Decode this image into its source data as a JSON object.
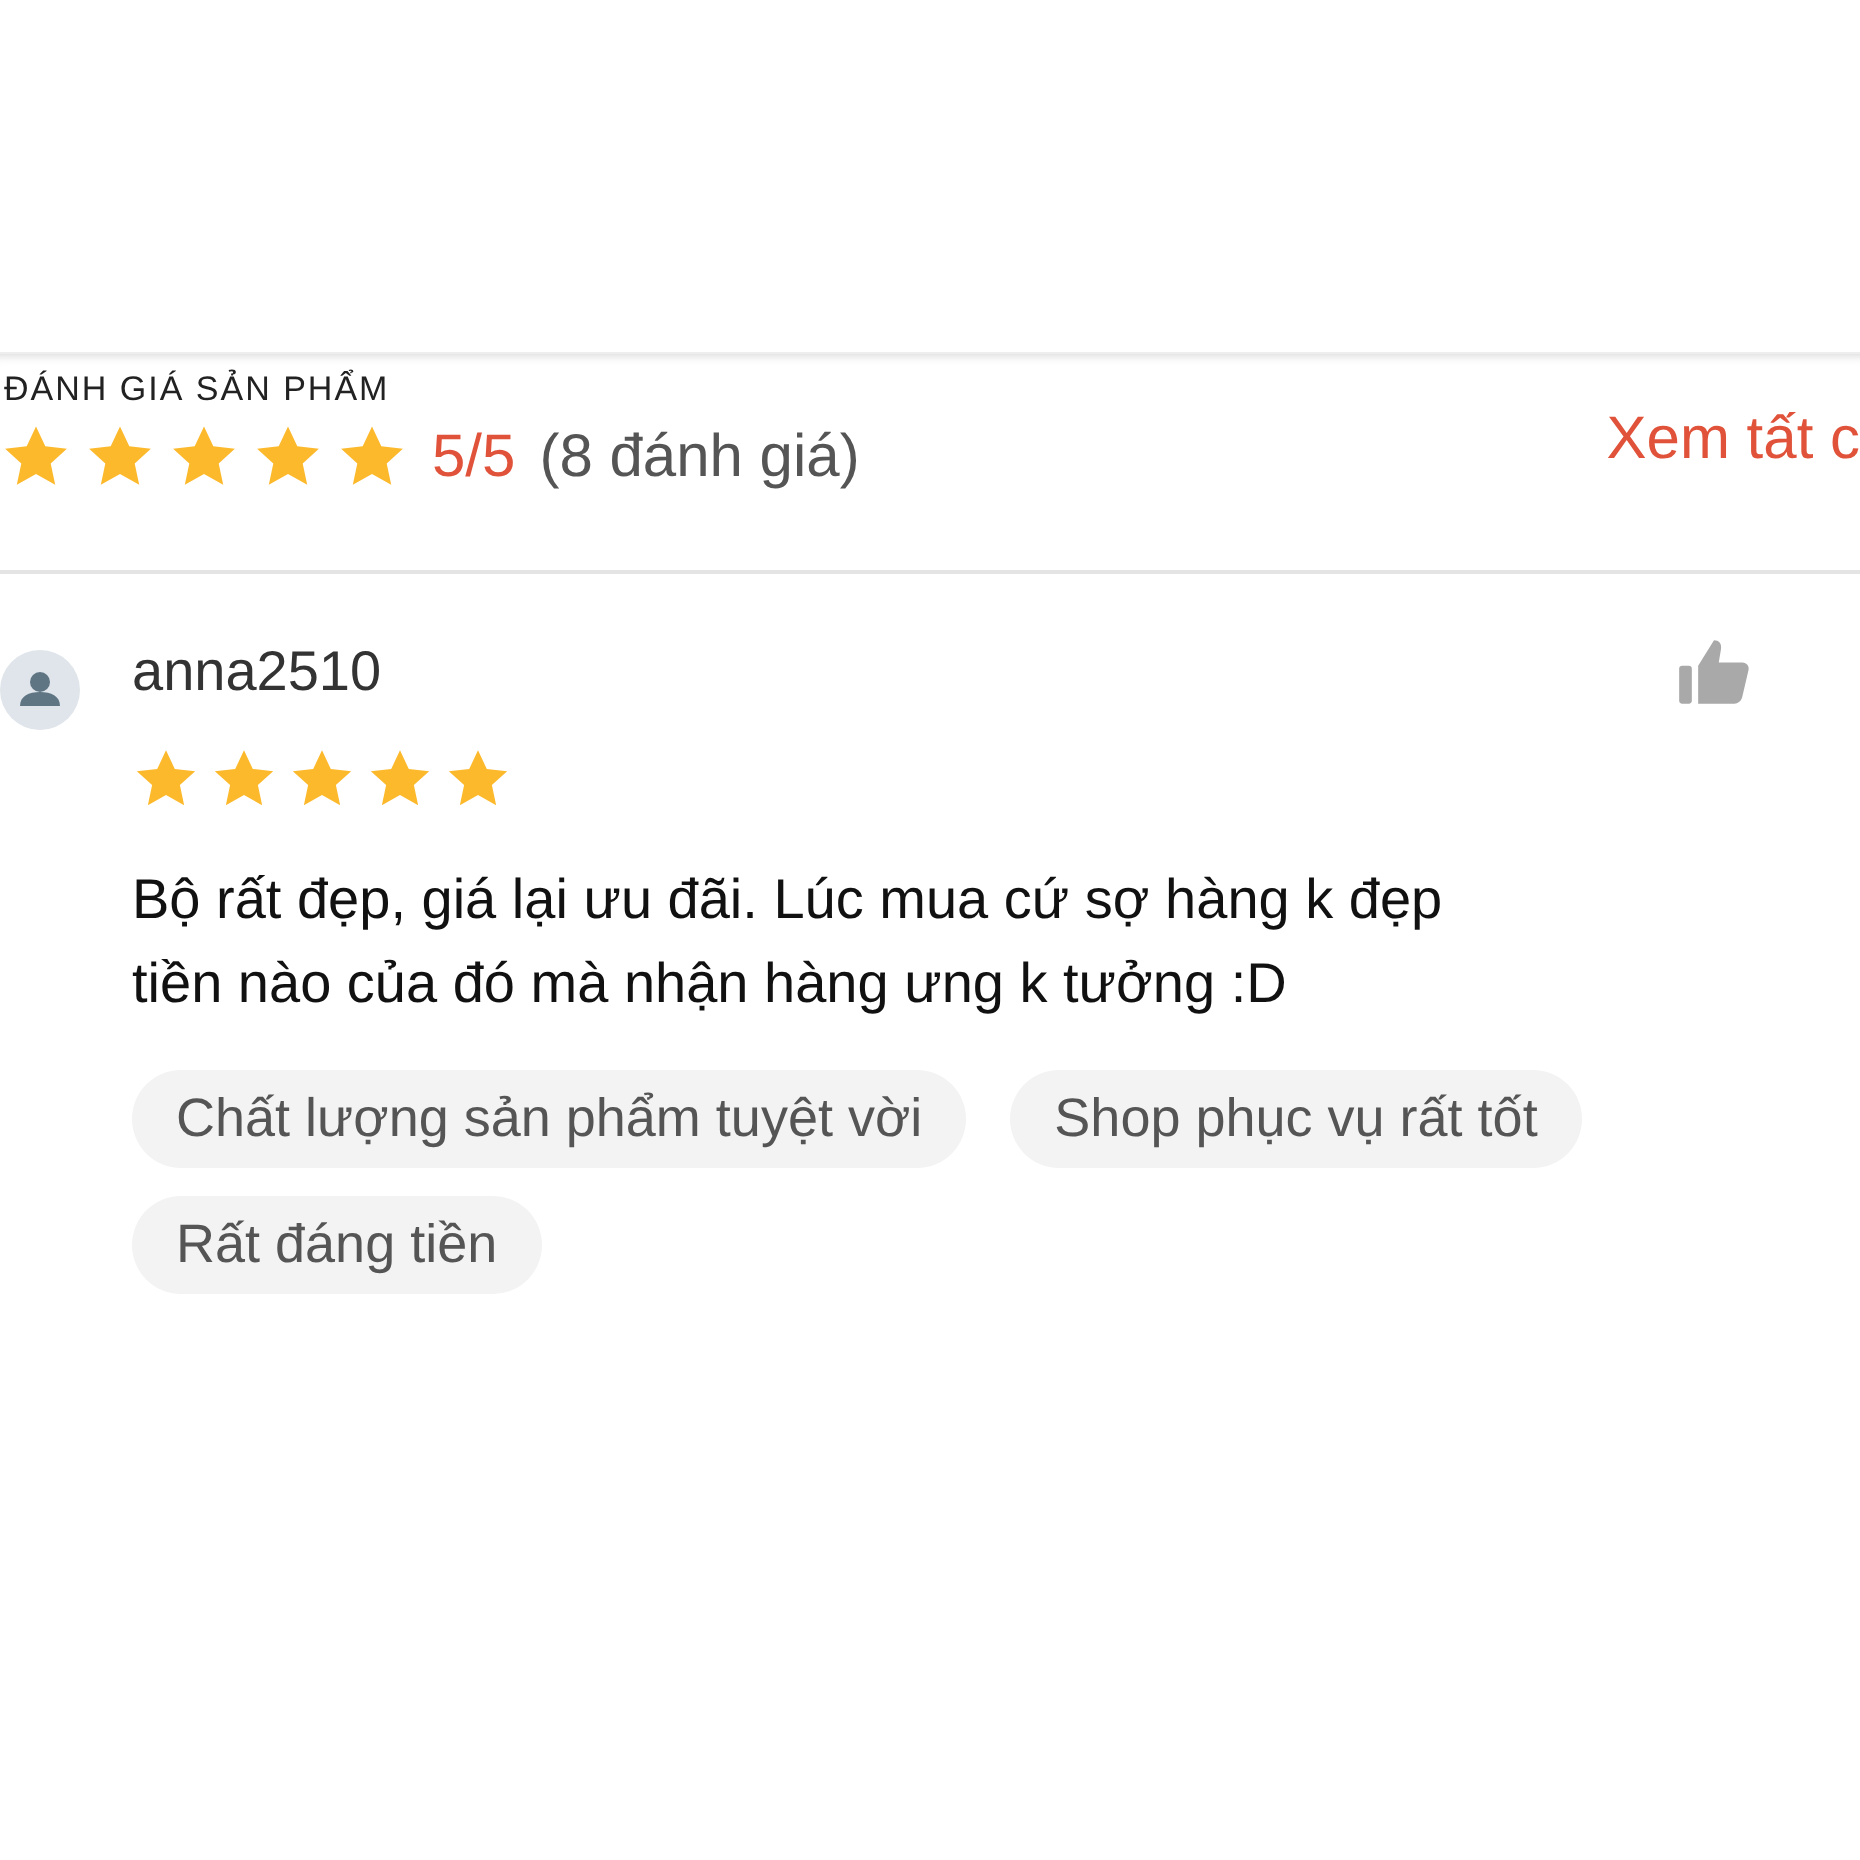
{
  "section": {
    "title": "ĐÁNH GIÁ SẢN PHẨM",
    "stars": 5,
    "score": "5/5",
    "count": "(8 đánh giá)",
    "see_all": "Xem tất c"
  },
  "review": {
    "user": "anna2510",
    "stars": 5,
    "lines": [
      "Bộ rất đẹp, giá lại ưu đãi. Lúc mua cứ sợ hàng k đẹp",
      "tiền nào của đó mà nhận hàng ưng k tưởng :D"
    ],
    "tags": [
      "Chất lượng sản phẩm tuyệt vời",
      "Shop phục vụ rất tốt",
      "Rất đáng tiền"
    ]
  }
}
